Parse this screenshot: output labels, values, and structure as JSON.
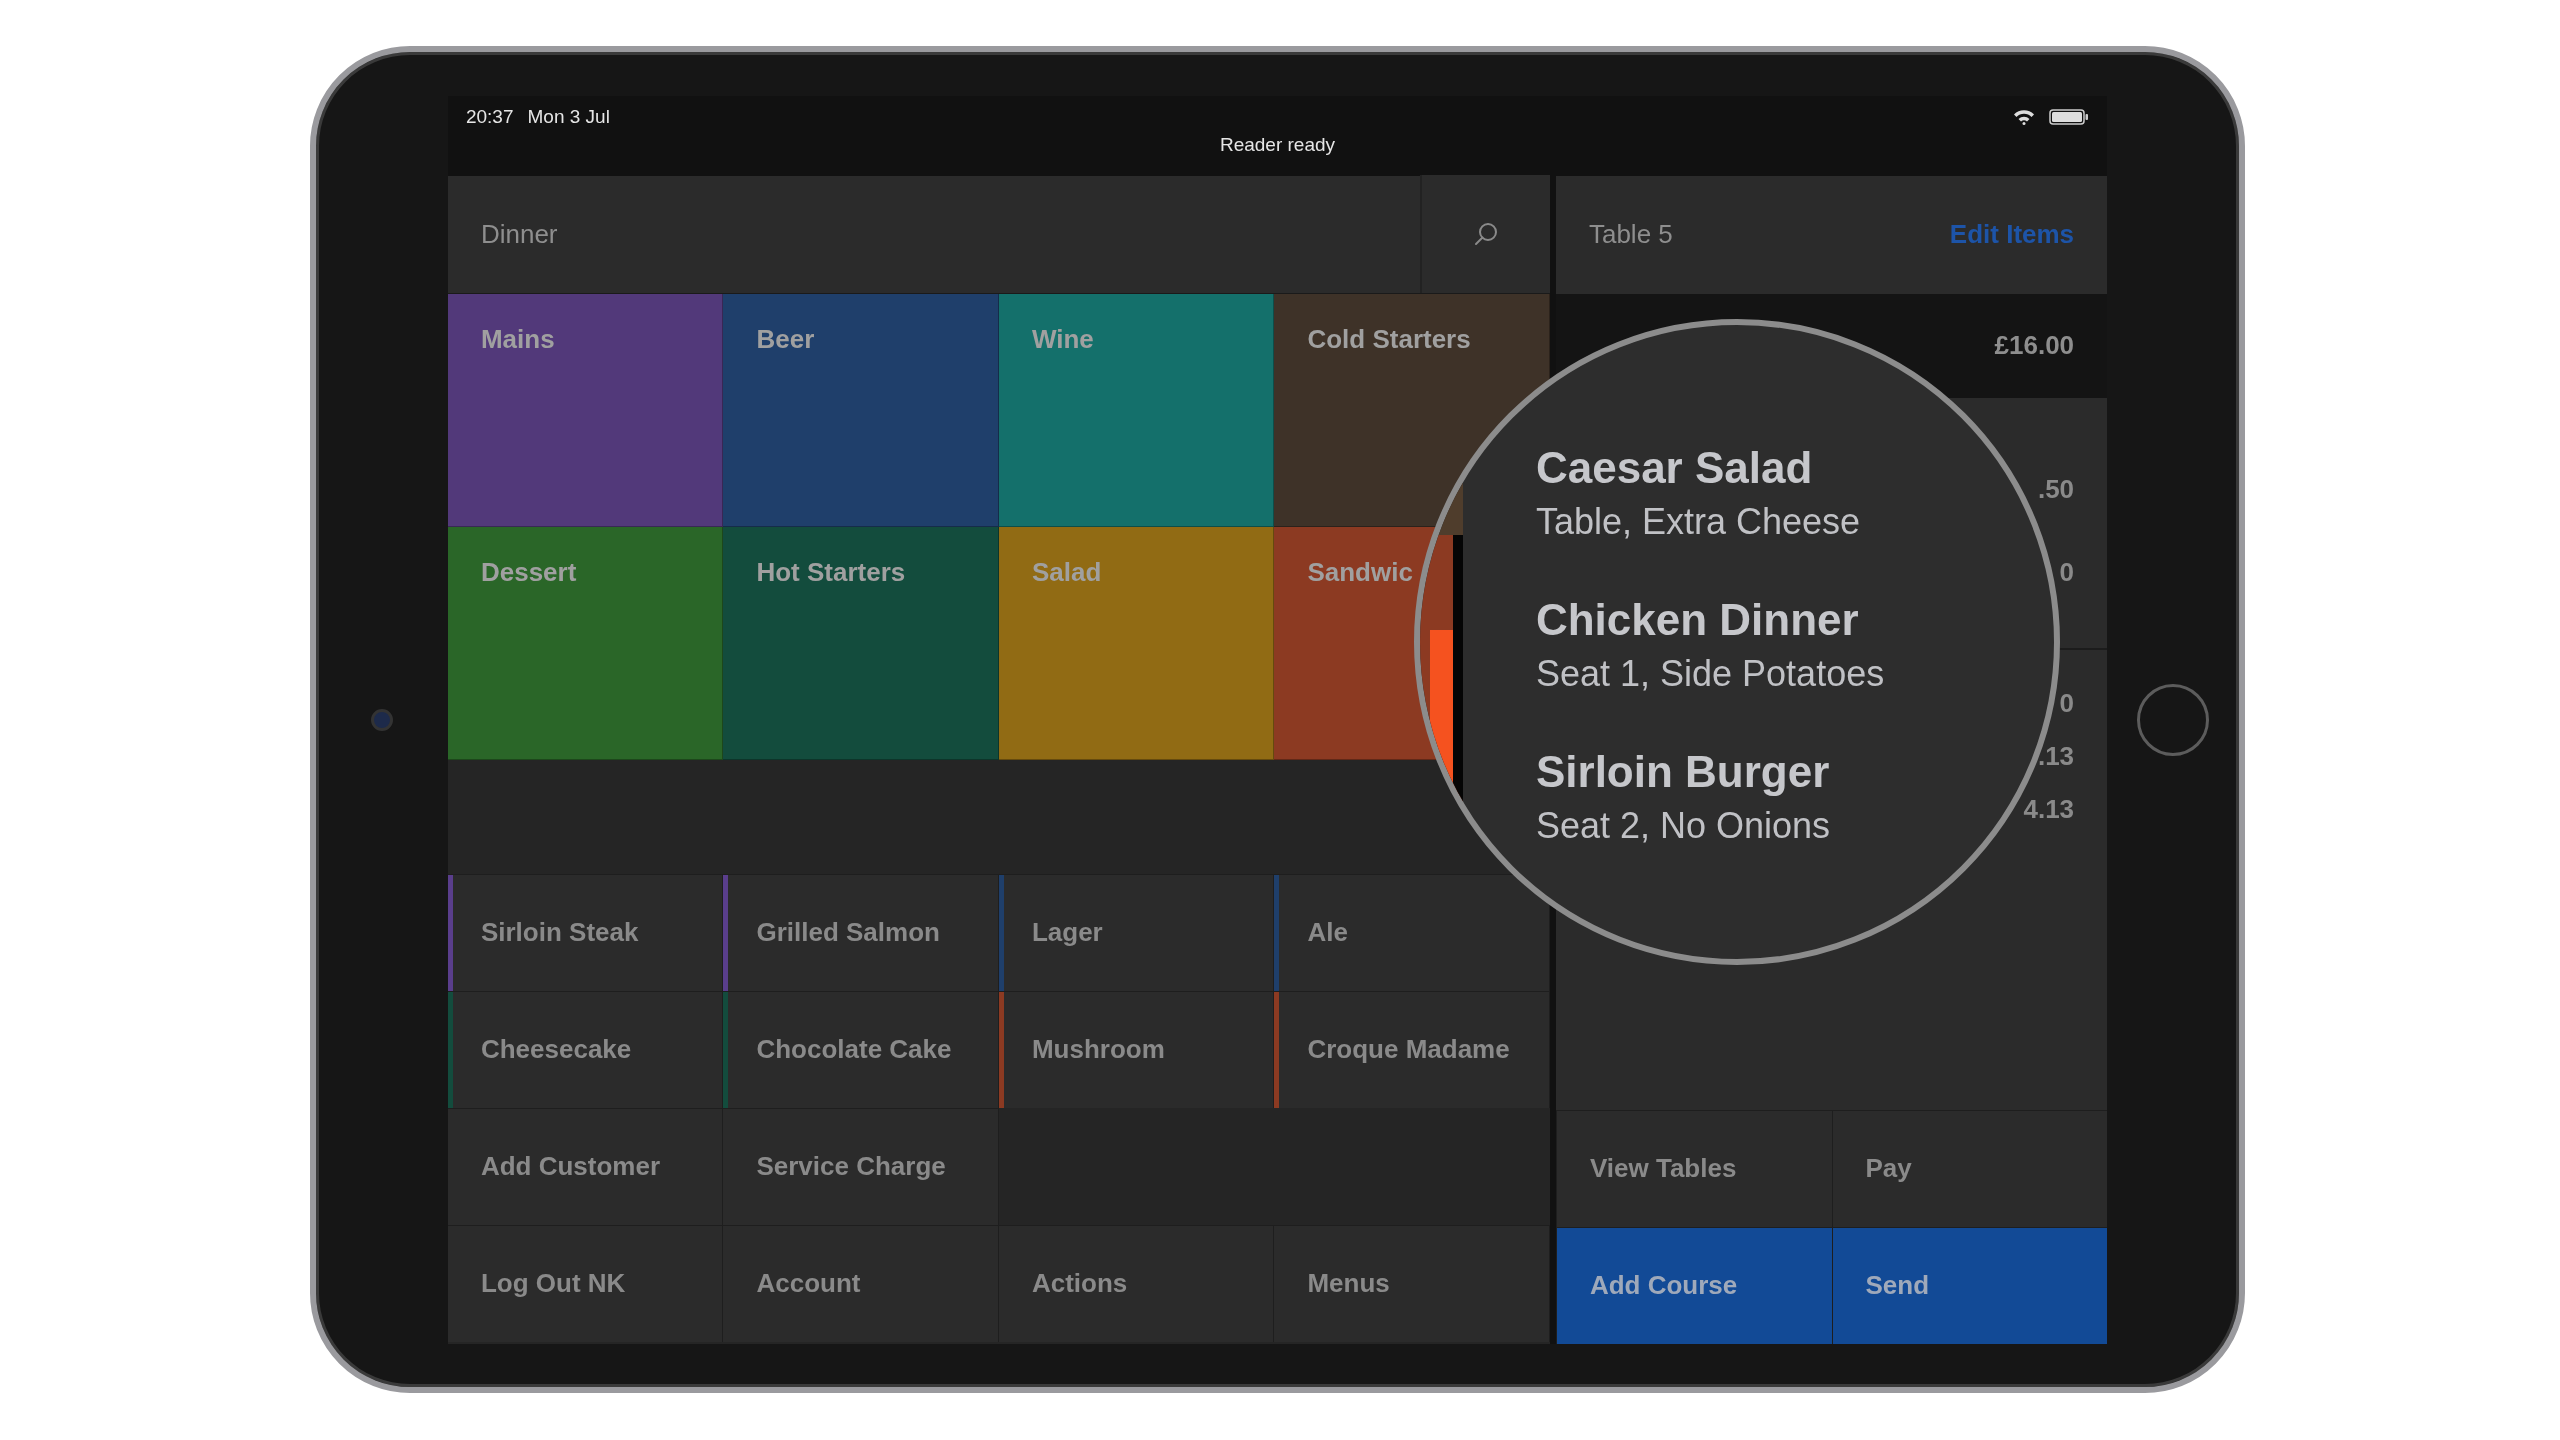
{
  "status_bar": {
    "time": "20:37",
    "date": "Mon 3 Jul",
    "message": "Reader ready"
  },
  "menu": {
    "title": "Dinner"
  },
  "categories": [
    {
      "label": "Mains",
      "color": "#52397a"
    },
    {
      "label": "Beer",
      "color": "#1f3f6b"
    },
    {
      "label": "Wine",
      "color": "#14706b"
    },
    {
      "label": "Cold Starters",
      "color": "#3e3228"
    },
    {
      "label": "Dessert",
      "color": "#2a6628"
    },
    {
      "label": "Hot Starters",
      "color": "#134c3d"
    },
    {
      "label": "Salad",
      "color": "#916b14"
    },
    {
      "label": "Sandwic",
      "color": "#8c3a22"
    }
  ],
  "items": [
    {
      "label": "Sirloin Steak",
      "color": "#5a3e8c"
    },
    {
      "label": "Grilled Salmon",
      "color": "#5a3e8c"
    },
    {
      "label": "Lager",
      "color": "#1f3f6b"
    },
    {
      "label": "Ale",
      "color": "#1f3f6b"
    },
    {
      "label": "Cheesecake",
      "color": "#134c3d"
    },
    {
      "label": "Chocolate Cake",
      "color": "#134c3d"
    },
    {
      "label": "Mushroom",
      "color": "#8c3a22"
    },
    {
      "label": "Croque Madame",
      "color": "#8c3a22"
    }
  ],
  "tool_rows": [
    {
      "buttons": [
        "Add Customer",
        "Service Charge"
      ]
    },
    {
      "buttons": [
        "Log Out NK",
        "Account",
        "Actions",
        "Menus"
      ]
    }
  ],
  "order": {
    "title": "Table 5",
    "edit_label": "Edit Items",
    "course": {
      "price": "£16.00"
    },
    "line_prices": [
      ".50",
      "0"
    ],
    "totals": [
      "0",
      ".13",
      "4.13"
    ]
  },
  "buttons": [
    {
      "label": "View Tables",
      "kind": "secondary"
    },
    {
      "label": "Pay",
      "kind": "secondary"
    },
    {
      "label": "Add Course",
      "kind": "primary"
    },
    {
      "label": "Send",
      "kind": "primary"
    }
  ],
  "magnifier": {
    "lines": [
      {
        "title": "Caesar Salad",
        "detail": "Table, Extra Cheese"
      },
      {
        "title": "Chicken Dinner",
        "detail": "Seat 1, Side Potatoes"
      },
      {
        "title": "Sirloin Burger",
        "detail": "Seat 2, No Onions"
      }
    ]
  }
}
